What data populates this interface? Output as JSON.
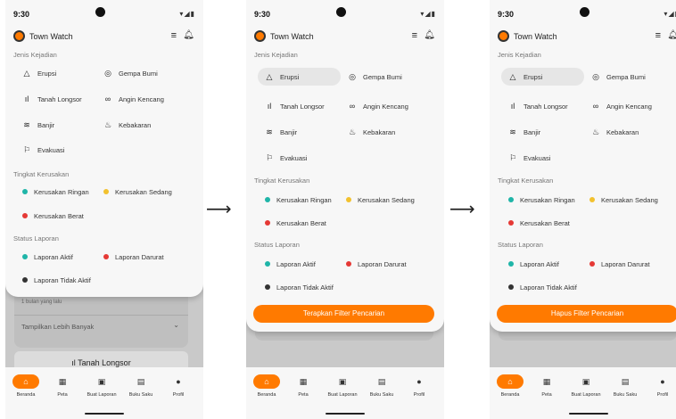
{
  "status": {
    "time": "9:30",
    "signal": "▾◢▮"
  },
  "app": {
    "title": "Town Watch"
  },
  "sections": {
    "kejadian": "Jenis Kejadian",
    "kerusakan": "Tingkat Kerusakan",
    "laporan": "Status Laporan"
  },
  "kejadian": [
    {
      "label": "Erupsi",
      "icon": "△"
    },
    {
      "label": "Gempa Bumi",
      "icon": "◎"
    },
    {
      "label": "Tanah Longsor",
      "icon": "ıl"
    },
    {
      "label": "Angin Kencang",
      "icon": "∞"
    },
    {
      "label": "Banjir",
      "icon": "≋"
    },
    {
      "label": "Kebakaran",
      "icon": "♨"
    },
    {
      "label": "Evakuasi",
      "icon": "⚐"
    }
  ],
  "kerusakan": [
    {
      "label": "Kerusakan Ringan",
      "color": "#1fb5a8"
    },
    {
      "label": "Kerusakan Sedang",
      "color": "#f2c12e"
    },
    {
      "label": "Kerusakan Berat",
      "color": "#e53935"
    }
  ],
  "laporan": [
    {
      "label": "Laporan Aktif",
      "color": "#1fb5a8"
    },
    {
      "label": "Laporan Darurat",
      "color": "#e53935"
    },
    {
      "label": "Laporan Tidak Aktif",
      "color": "#333333"
    }
  ],
  "screen1_under": {
    "subtext": "1 bulan yang lalu",
    "more": "Tampilkan Lebih Banyak",
    "card": "Tanah Longsor"
  },
  "buttons": {
    "apply": "Terapkan Filter Pencarian",
    "clear": "Hapus Filter Pencarian"
  },
  "nav": [
    {
      "label": "Beranda",
      "icon": "⌂"
    },
    {
      "label": "Peta",
      "icon": "▦"
    },
    {
      "label": "Buat Laporan",
      "icon": "▣"
    },
    {
      "label": "Buku Saku",
      "icon": "▤"
    },
    {
      "label": "Profil",
      "icon": "●"
    }
  ],
  "arrow": "⟶"
}
